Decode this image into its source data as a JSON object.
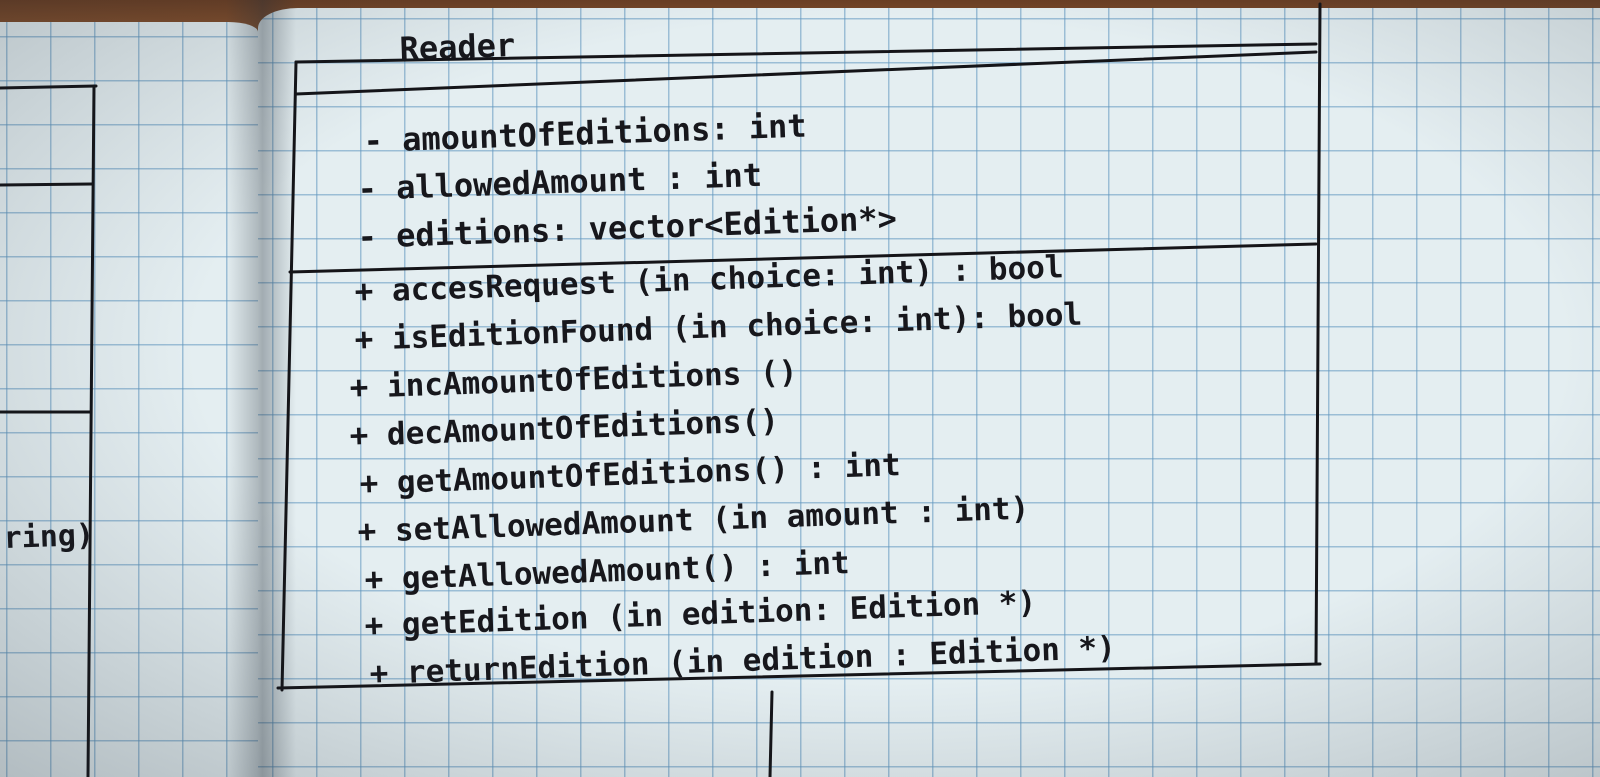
{
  "class_name": "Reader",
  "attributes": [
    "- amountOfEditions: int",
    "- allowedAmount : int",
    "- editions: vector<Edition*>"
  ],
  "methods": [
    "+ accesRequest (in choice: int) : bool",
    "+ isEditionFound (in choice: int): bool",
    "+ incAmountOfEditions ()",
    "+ decAmountOfEditions()",
    "+ getAmountOfEditions() : int",
    "+ setAllowedAmount (in amount : int)",
    "+ getAllowedAmount() : int",
    "+ getEdition (in edition: Edition *)",
    "+ returnEdition (in edition : Edition *)"
  ],
  "left_fragment_text": "ring)",
  "ink_color": "#17171c"
}
